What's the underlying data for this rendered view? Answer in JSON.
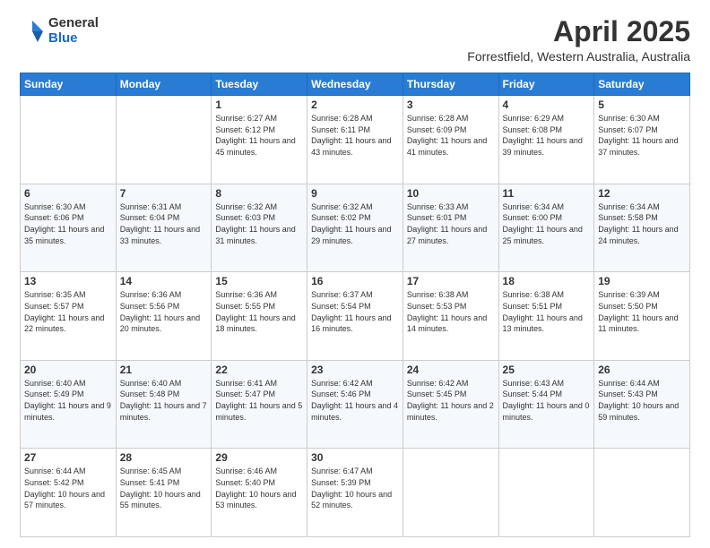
{
  "logo": {
    "general": "General",
    "blue": "Blue"
  },
  "header": {
    "month": "April 2025",
    "location": "Forrestfield, Western Australia, Australia"
  },
  "weekdays": [
    "Sunday",
    "Monday",
    "Tuesday",
    "Wednesday",
    "Thursday",
    "Friday",
    "Saturday"
  ],
  "weeks": [
    [
      {
        "day": "",
        "info": ""
      },
      {
        "day": "",
        "info": ""
      },
      {
        "day": "1",
        "info": "Sunrise: 6:27 AM\nSunset: 6:12 PM\nDaylight: 11 hours and 45 minutes."
      },
      {
        "day": "2",
        "info": "Sunrise: 6:28 AM\nSunset: 6:11 PM\nDaylight: 11 hours and 43 minutes."
      },
      {
        "day": "3",
        "info": "Sunrise: 6:28 AM\nSunset: 6:09 PM\nDaylight: 11 hours and 41 minutes."
      },
      {
        "day": "4",
        "info": "Sunrise: 6:29 AM\nSunset: 6:08 PM\nDaylight: 11 hours and 39 minutes."
      },
      {
        "day": "5",
        "info": "Sunrise: 6:30 AM\nSunset: 6:07 PM\nDaylight: 11 hours and 37 minutes."
      }
    ],
    [
      {
        "day": "6",
        "info": "Sunrise: 6:30 AM\nSunset: 6:06 PM\nDaylight: 11 hours and 35 minutes."
      },
      {
        "day": "7",
        "info": "Sunrise: 6:31 AM\nSunset: 6:04 PM\nDaylight: 11 hours and 33 minutes."
      },
      {
        "day": "8",
        "info": "Sunrise: 6:32 AM\nSunset: 6:03 PM\nDaylight: 11 hours and 31 minutes."
      },
      {
        "day": "9",
        "info": "Sunrise: 6:32 AM\nSunset: 6:02 PM\nDaylight: 11 hours and 29 minutes."
      },
      {
        "day": "10",
        "info": "Sunrise: 6:33 AM\nSunset: 6:01 PM\nDaylight: 11 hours and 27 minutes."
      },
      {
        "day": "11",
        "info": "Sunrise: 6:34 AM\nSunset: 6:00 PM\nDaylight: 11 hours and 25 minutes."
      },
      {
        "day": "12",
        "info": "Sunrise: 6:34 AM\nSunset: 5:58 PM\nDaylight: 11 hours and 24 minutes."
      }
    ],
    [
      {
        "day": "13",
        "info": "Sunrise: 6:35 AM\nSunset: 5:57 PM\nDaylight: 11 hours and 22 minutes."
      },
      {
        "day": "14",
        "info": "Sunrise: 6:36 AM\nSunset: 5:56 PM\nDaylight: 11 hours and 20 minutes."
      },
      {
        "day": "15",
        "info": "Sunrise: 6:36 AM\nSunset: 5:55 PM\nDaylight: 11 hours and 18 minutes."
      },
      {
        "day": "16",
        "info": "Sunrise: 6:37 AM\nSunset: 5:54 PM\nDaylight: 11 hours and 16 minutes."
      },
      {
        "day": "17",
        "info": "Sunrise: 6:38 AM\nSunset: 5:53 PM\nDaylight: 11 hours and 14 minutes."
      },
      {
        "day": "18",
        "info": "Sunrise: 6:38 AM\nSunset: 5:51 PM\nDaylight: 11 hours and 13 minutes."
      },
      {
        "day": "19",
        "info": "Sunrise: 6:39 AM\nSunset: 5:50 PM\nDaylight: 11 hours and 11 minutes."
      }
    ],
    [
      {
        "day": "20",
        "info": "Sunrise: 6:40 AM\nSunset: 5:49 PM\nDaylight: 11 hours and 9 minutes."
      },
      {
        "day": "21",
        "info": "Sunrise: 6:40 AM\nSunset: 5:48 PM\nDaylight: 11 hours and 7 minutes."
      },
      {
        "day": "22",
        "info": "Sunrise: 6:41 AM\nSunset: 5:47 PM\nDaylight: 11 hours and 5 minutes."
      },
      {
        "day": "23",
        "info": "Sunrise: 6:42 AM\nSunset: 5:46 PM\nDaylight: 11 hours and 4 minutes."
      },
      {
        "day": "24",
        "info": "Sunrise: 6:42 AM\nSunset: 5:45 PM\nDaylight: 11 hours and 2 minutes."
      },
      {
        "day": "25",
        "info": "Sunrise: 6:43 AM\nSunset: 5:44 PM\nDaylight: 11 hours and 0 minutes."
      },
      {
        "day": "26",
        "info": "Sunrise: 6:44 AM\nSunset: 5:43 PM\nDaylight: 10 hours and 59 minutes."
      }
    ],
    [
      {
        "day": "27",
        "info": "Sunrise: 6:44 AM\nSunset: 5:42 PM\nDaylight: 10 hours and 57 minutes."
      },
      {
        "day": "28",
        "info": "Sunrise: 6:45 AM\nSunset: 5:41 PM\nDaylight: 10 hours and 55 minutes."
      },
      {
        "day": "29",
        "info": "Sunrise: 6:46 AM\nSunset: 5:40 PM\nDaylight: 10 hours and 53 minutes."
      },
      {
        "day": "30",
        "info": "Sunrise: 6:47 AM\nSunset: 5:39 PM\nDaylight: 10 hours and 52 minutes."
      },
      {
        "day": "",
        "info": ""
      },
      {
        "day": "",
        "info": ""
      },
      {
        "day": "",
        "info": ""
      }
    ]
  ]
}
